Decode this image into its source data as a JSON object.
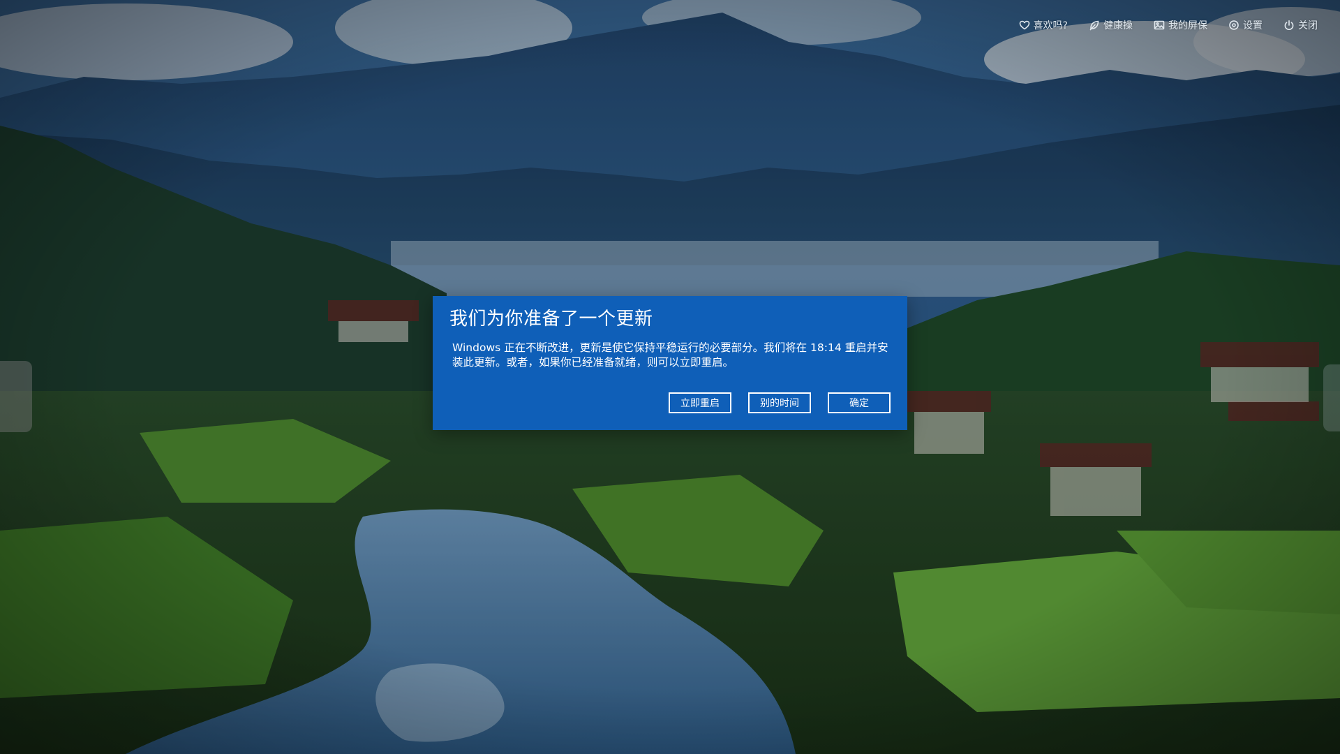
{
  "topbar": {
    "items": [
      {
        "label": "喜欢吗?",
        "icon": "heart-icon"
      },
      {
        "label": "健康操",
        "icon": "leaf-icon"
      },
      {
        "label": "我的屏保",
        "icon": "picture-icon"
      },
      {
        "label": "设置",
        "icon": "settings-icon"
      },
      {
        "label": "关闭",
        "icon": "power-icon"
      }
    ]
  },
  "dialog": {
    "title": "我们为你准备了一个更新",
    "body": "Windows 正在不断改进，更新是使它保持平稳运行的必要部分。我们将在 18:14 重启并安装此更新。或者，如果你已经准备就绪，则可以立即重启。",
    "buttons": {
      "restart_now": "立即重启",
      "another_time": "别的时间",
      "ok": "确定"
    },
    "background_color": "#0f5fb8"
  },
  "colors": {
    "sky": "#2c5a8c",
    "mountain": "#24476f",
    "forest": "#1f4a2c",
    "field": "#5c9a38",
    "river": "#4d7fa8"
  }
}
